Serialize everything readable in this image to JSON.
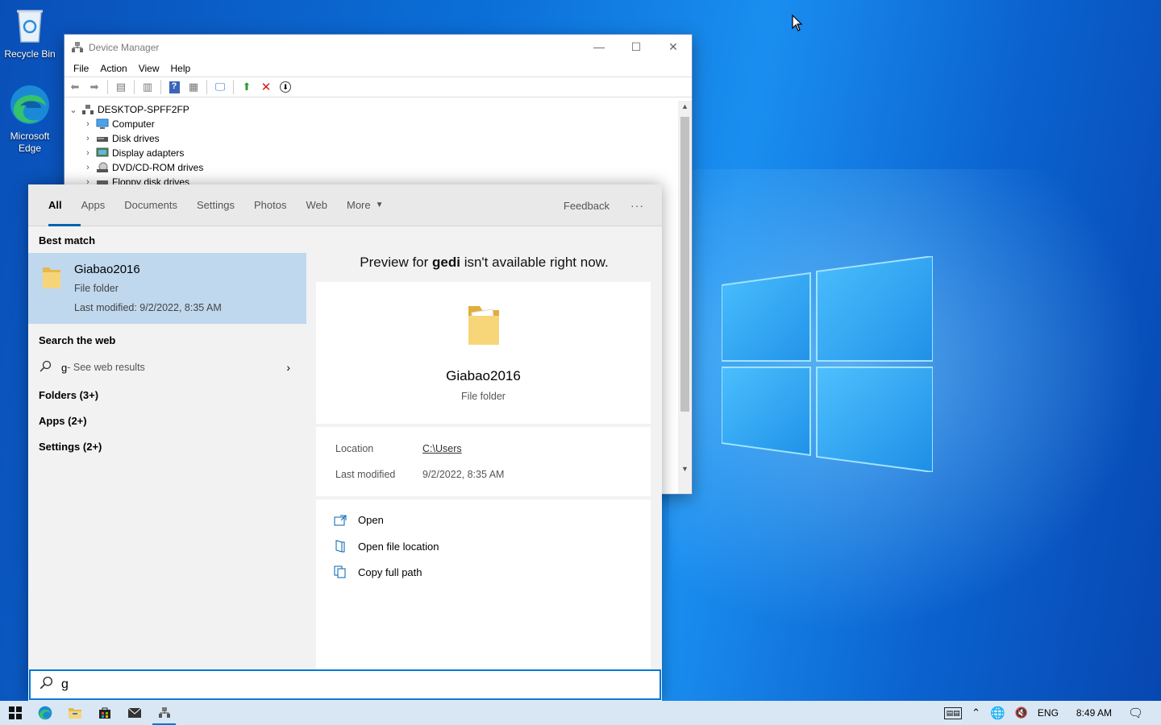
{
  "desktop": {
    "icons": [
      {
        "label": "Recycle Bin",
        "icon": "recycle-bin-icon"
      },
      {
        "label": "Microsoft Edge",
        "icon": "edge-icon"
      }
    ]
  },
  "device_manager": {
    "title": "Device Manager",
    "menu": [
      "File",
      "Action",
      "View",
      "Help"
    ],
    "toolbar_icons": [
      "back-icon",
      "forward-icon",
      "properties-icon",
      "update-icon",
      "help-icon",
      "details-icon",
      "scan-hardware-icon",
      "enable-device-icon",
      "uninstall-icon",
      "download-icon"
    ],
    "tree": {
      "root": "DESKTOP-SPFF2FP",
      "items": [
        "Computer",
        "Disk drives",
        "Display adapters",
        "DVD/CD-ROM drives",
        "Floppy disk drives"
      ]
    }
  },
  "search": {
    "tabs": [
      "All",
      "Apps",
      "Documents",
      "Settings",
      "Photos",
      "Web",
      "More"
    ],
    "feedback": "Feedback",
    "more_options": "···",
    "best_match_heading": "Best match",
    "best_match": {
      "name": "Giabao2016",
      "type": "File folder",
      "modified": "Last modified: 9/2/2022, 8:35 AM"
    },
    "web_heading": "Search the web",
    "web_query": "g",
    "web_suffix": " - See web results",
    "categories": [
      "Folders (3+)",
      "Apps (2+)",
      "Settings (2+)"
    ],
    "preview_prefix": "Preview for ",
    "preview_term": "gedi",
    "preview_suffix": " isn't available right now.",
    "preview": {
      "name": "Giabao2016",
      "type": "File folder",
      "location_label": "Location",
      "location_value": "C:\\Users",
      "modified_label": "Last modified",
      "modified_value": "9/2/2022, 8:35 AM"
    },
    "actions": [
      "Open",
      "Open file location",
      "Copy full path"
    ],
    "input_value": "g"
  },
  "taskbar": {
    "apps": [
      "start-icon",
      "edge-icon",
      "file-explorer-icon",
      "store-icon",
      "mail-icon",
      "device-manager-icon"
    ],
    "language": "ENG",
    "time": "8:49 AM"
  },
  "colors": {
    "accent": "#0078d7",
    "selection": "#c0d8ee"
  }
}
